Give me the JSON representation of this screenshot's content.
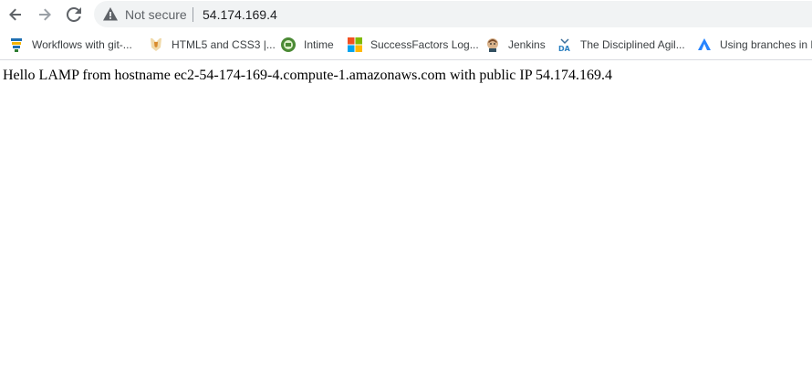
{
  "browser": {
    "security_label": "Not secure",
    "url": "54.174.169.4"
  },
  "nav": {
    "back_icon": "arrow-left-icon",
    "forward_icon": "arrow-right-icon",
    "reload_icon": "reload-icon",
    "warning_icon": "warning-triangle-icon"
  },
  "bookmarks": [
    {
      "label": "Workflows with git-...",
      "icon": "gitlab-icon"
    },
    {
      "label": "HTML5 and CSS3 |...",
      "icon": "html5-badge-icon"
    },
    {
      "label": "Intime",
      "icon": "intime-logo-icon"
    },
    {
      "label": "SuccessFactors Log...",
      "icon": "microsoft-logo-icon"
    },
    {
      "label": "Jenkins",
      "icon": "jenkins-icon"
    },
    {
      "label": "The Disciplined Agil...",
      "icon": "da-logo-icon"
    },
    {
      "label": "Using branches in B",
      "icon": "bitbucket-icon"
    }
  ],
  "page": {
    "message": "Hello LAMP from hostname ec2-54-174-169-4.compute-1.amazonaws.com with public IP 54.174.169.4"
  }
}
